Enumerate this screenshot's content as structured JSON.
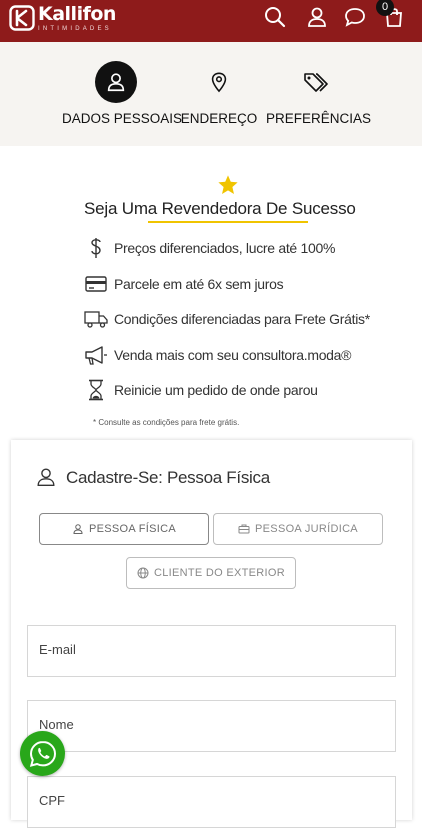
{
  "brand": {
    "name": "Kallifon",
    "tagline": "INTIMIDADES",
    "color": "#8e1b1b"
  },
  "header": {
    "icons": [
      "search-icon",
      "user-icon",
      "chat-icon",
      "cart-icon"
    ],
    "cart_count": "0"
  },
  "steps": [
    {
      "label": "DADOS PESSOAIS",
      "icon": "user-icon",
      "active": true
    },
    {
      "label": "ENDEREÇO",
      "icon": "location-pin-icon",
      "active": false
    },
    {
      "label": "PREFERÊNCIAS",
      "icon": "tags-icon",
      "active": false
    }
  ],
  "benefits": {
    "title": "Seja Uma Revendedora De Sucesso",
    "items": [
      {
        "icon": "dollar-icon",
        "text": "Preços diferenciados, lucre até 100%"
      },
      {
        "icon": "credit-card-icon",
        "text": "Parcele em até 6x sem juros"
      },
      {
        "icon": "truck-icon",
        "text": "Condições diferenciadas para Frete Grátis*"
      },
      {
        "icon": "megaphone-icon",
        "text": "Venda mais com seu consultora.moda®"
      },
      {
        "icon": "hourglass-icon",
        "text": "Reinicie um pedido de onde parou"
      }
    ],
    "footnote": "* Consulte as condições para frete grátis.",
    "accent": "#f0c400"
  },
  "form": {
    "title": "Cadastre-Se: Pessoa Física",
    "person_types": [
      {
        "label": "PESSOA FÍSICA",
        "icon": "user-icon",
        "selected": true
      },
      {
        "label": "PESSOA JURÍDICA",
        "icon": "briefcase-icon",
        "selected": false
      },
      {
        "label": "CLIENTE DO EXTERIOR",
        "icon": "globe-icon",
        "selected": false
      }
    ],
    "fields": [
      {
        "label": "E-mail"
      },
      {
        "label": "Nome"
      },
      {
        "label": "CPF"
      }
    ]
  },
  "whatsapp": {
    "icon": "whatsapp-icon",
    "color": "#29a71a"
  }
}
